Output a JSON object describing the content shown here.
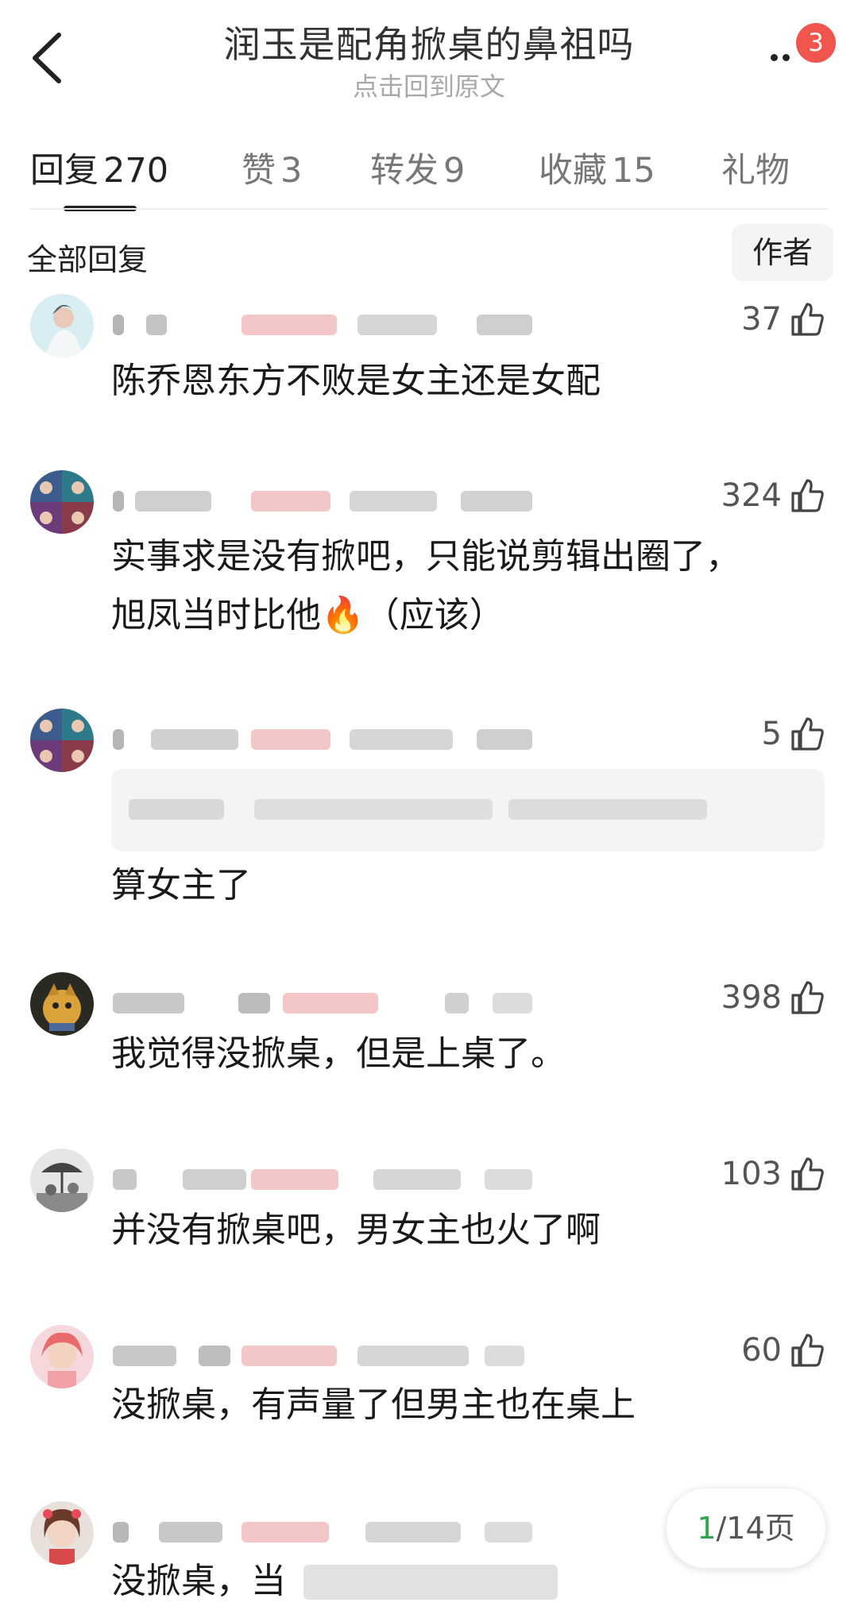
{
  "header": {
    "title": "润玉是配角掀桌的鼻祖吗",
    "subtitle": "点击回到原文",
    "notification_count": "3"
  },
  "tabs": [
    {
      "label": "回复",
      "count": "270"
    },
    {
      "label": "赞",
      "count": "3"
    },
    {
      "label": "转发",
      "count": "9"
    },
    {
      "label": "收藏",
      "count": "15"
    },
    {
      "label": "礼物",
      "count": ""
    }
  ],
  "section": {
    "title": "全部回复",
    "author_filter": "作者"
  },
  "comments": [
    {
      "likes": "37",
      "lines": [
        "陈乔恩东方不败是女主还是女配"
      ]
    },
    {
      "likes": "324",
      "lines": [
        "实事求是没有掀吧，只能说剪辑出圈了，",
        "旭凤当时比他🔥（应该）"
      ]
    },
    {
      "likes": "5",
      "lines": [
        "算女主了"
      ]
    },
    {
      "likes": "398",
      "lines": [
        "我觉得没掀桌，但是上桌了。"
      ]
    },
    {
      "likes": "103",
      "lines": [
        "并没有掀桌吧，男女主也火了啊"
      ]
    },
    {
      "likes": "60",
      "lines": [
        "没掀桌，有声量了但男主也在桌上"
      ]
    },
    {
      "likes": "",
      "lines": [
        "没掀桌，当"
      ]
    }
  ],
  "pager": {
    "current": "1",
    "total_text": "/14页"
  },
  "icons": {
    "back": "back-arrow-icon",
    "more": "more-dots-icon",
    "like": "thumbs-up-icon"
  },
  "colors": {
    "badge": "#f0554e",
    "pager_current": "#2aa84a",
    "blur_tag": "#f3c7c7"
  }
}
